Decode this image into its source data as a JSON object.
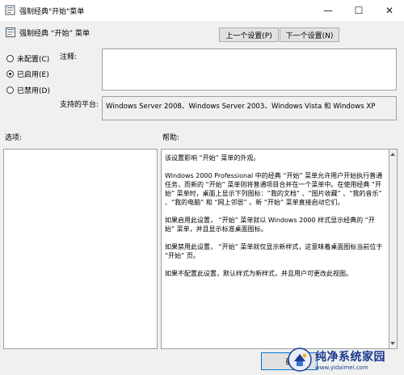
{
  "window": {
    "title": "强制经典\"开始\"菜单",
    "controls": {
      "minimize": "—",
      "maximize": "☐",
      "close": "✕"
    }
  },
  "header": {
    "policy_title": "强制经典 “开始” 菜单",
    "prev_button": "上一个设置(P)",
    "next_button": "下一个设置(N)"
  },
  "state": {
    "options": [
      {
        "label": "未配置(C)",
        "checked": false
      },
      {
        "label": "已启用(E)",
        "checked": true
      },
      {
        "label": "已禁用(D)",
        "checked": false
      }
    ]
  },
  "comment": {
    "label": "注释:",
    "value": ""
  },
  "platform": {
    "label": "支持的平台:",
    "value": "Windows Server 2008、Windows Server 2003、Windows Vista 和 Windows XP"
  },
  "sections": {
    "options_label": "选项:",
    "help_label": "帮助:"
  },
  "help": {
    "paragraphs": [
      "该设置影响 “开始” 菜单的外观。",
      "Windows 2000 Professional 中的经典 “开始” 菜单允许用户开始执行普通任务，而新的 “开始” 菜单则将普通项目合并在一个菜单中。在使用经典 “开始” 菜单时，桌面上显示下列图标：“我的文档” 、“图片收藏” 、“我的音乐” 、“我的电脑” 和 “网上邻居” 。新 “开始” 菜单直接启动它们。",
      "如果启用此设置， “开始” 菜单就以 Windows 2000 样式显示经典的 “开始” 菜单，并且显示标准桌面图标。",
      "如果禁用此设置， “开始” 菜单就仅显示新样式，这意味着桌面图标当前位于 “开始” 页。",
      "如果不配置此设置，默认样式为新样式，并且用户可更改此视图。"
    ]
  },
  "footer": {
    "ok_button": "确"
  },
  "watermark": {
    "main": "纯净系统家园",
    "sub": "www.yidaimei.com"
  }
}
